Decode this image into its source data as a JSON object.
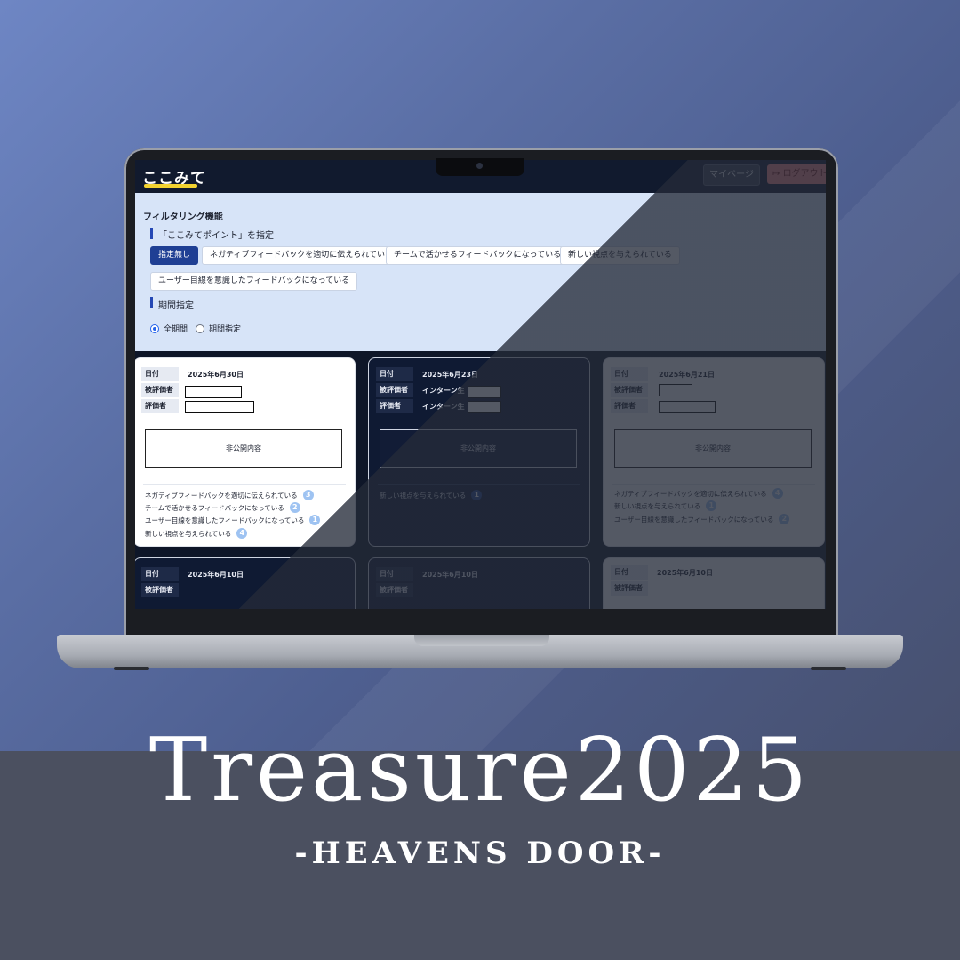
{
  "app": {
    "logo": "ここみて",
    "mypage_label": "マイページ",
    "logout_label": "ログアウト",
    "logout_icon": "logout-arrow-icon"
  },
  "filter": {
    "title": "フィルタリング機能",
    "point_section": "「ここみてポイント」を指定",
    "chips": [
      "指定無し",
      "ネガティブフィードバックを適切に伝えられている",
      "チームで活かせるフィードバックになっている",
      "新しい視点を与えられている",
      "ユーザー目線を意識したフィードバックになっている"
    ],
    "period_section": "期間指定",
    "period_options": [
      "全期間",
      "期間指定"
    ],
    "selected_period": "全期間"
  },
  "labels": {
    "date": "日付",
    "evaluatee": "被評価者",
    "evaluator": "評価者",
    "secret": "非公開内容"
  },
  "cards": [
    {
      "date": "2025年6月30日",
      "evaluatee": "",
      "evaluator": "",
      "points": [
        {
          "label": "ネガティブフィードバックを適切に伝えられている",
          "count": "3"
        },
        {
          "label": "チームで活かせるフィードバックになっている",
          "count": "2"
        },
        {
          "label": "ユーザー目線を意識したフィードバックになっている",
          "count": "1"
        },
        {
          "label": "新しい視点を与えられている",
          "count": "4"
        }
      ]
    },
    {
      "date": "2025年6月23日",
      "evaluatee": "インターン生",
      "evaluator": "インターン生",
      "points": [
        {
          "label": "新しい視点を与えられている",
          "count": "1"
        }
      ]
    },
    {
      "date": "2025年6月21日",
      "evaluatee": "",
      "evaluator": "",
      "points": [
        {
          "label": "ネガティブフィードバックを適切に伝えられている",
          "count": "4"
        },
        {
          "label": "新しい視点を与えられている",
          "count": "1"
        },
        {
          "label": "ユーザー目線を意識したフィードバックになっている",
          "count": "2"
        }
      ]
    },
    {
      "date": "2025年6月10日"
    },
    {
      "date": "2025年6月10日"
    },
    {
      "date": "2025年6月10日"
    }
  ],
  "branding": {
    "title": "Treasure2025",
    "subtitle": "-HEAVENS DOOR-"
  }
}
